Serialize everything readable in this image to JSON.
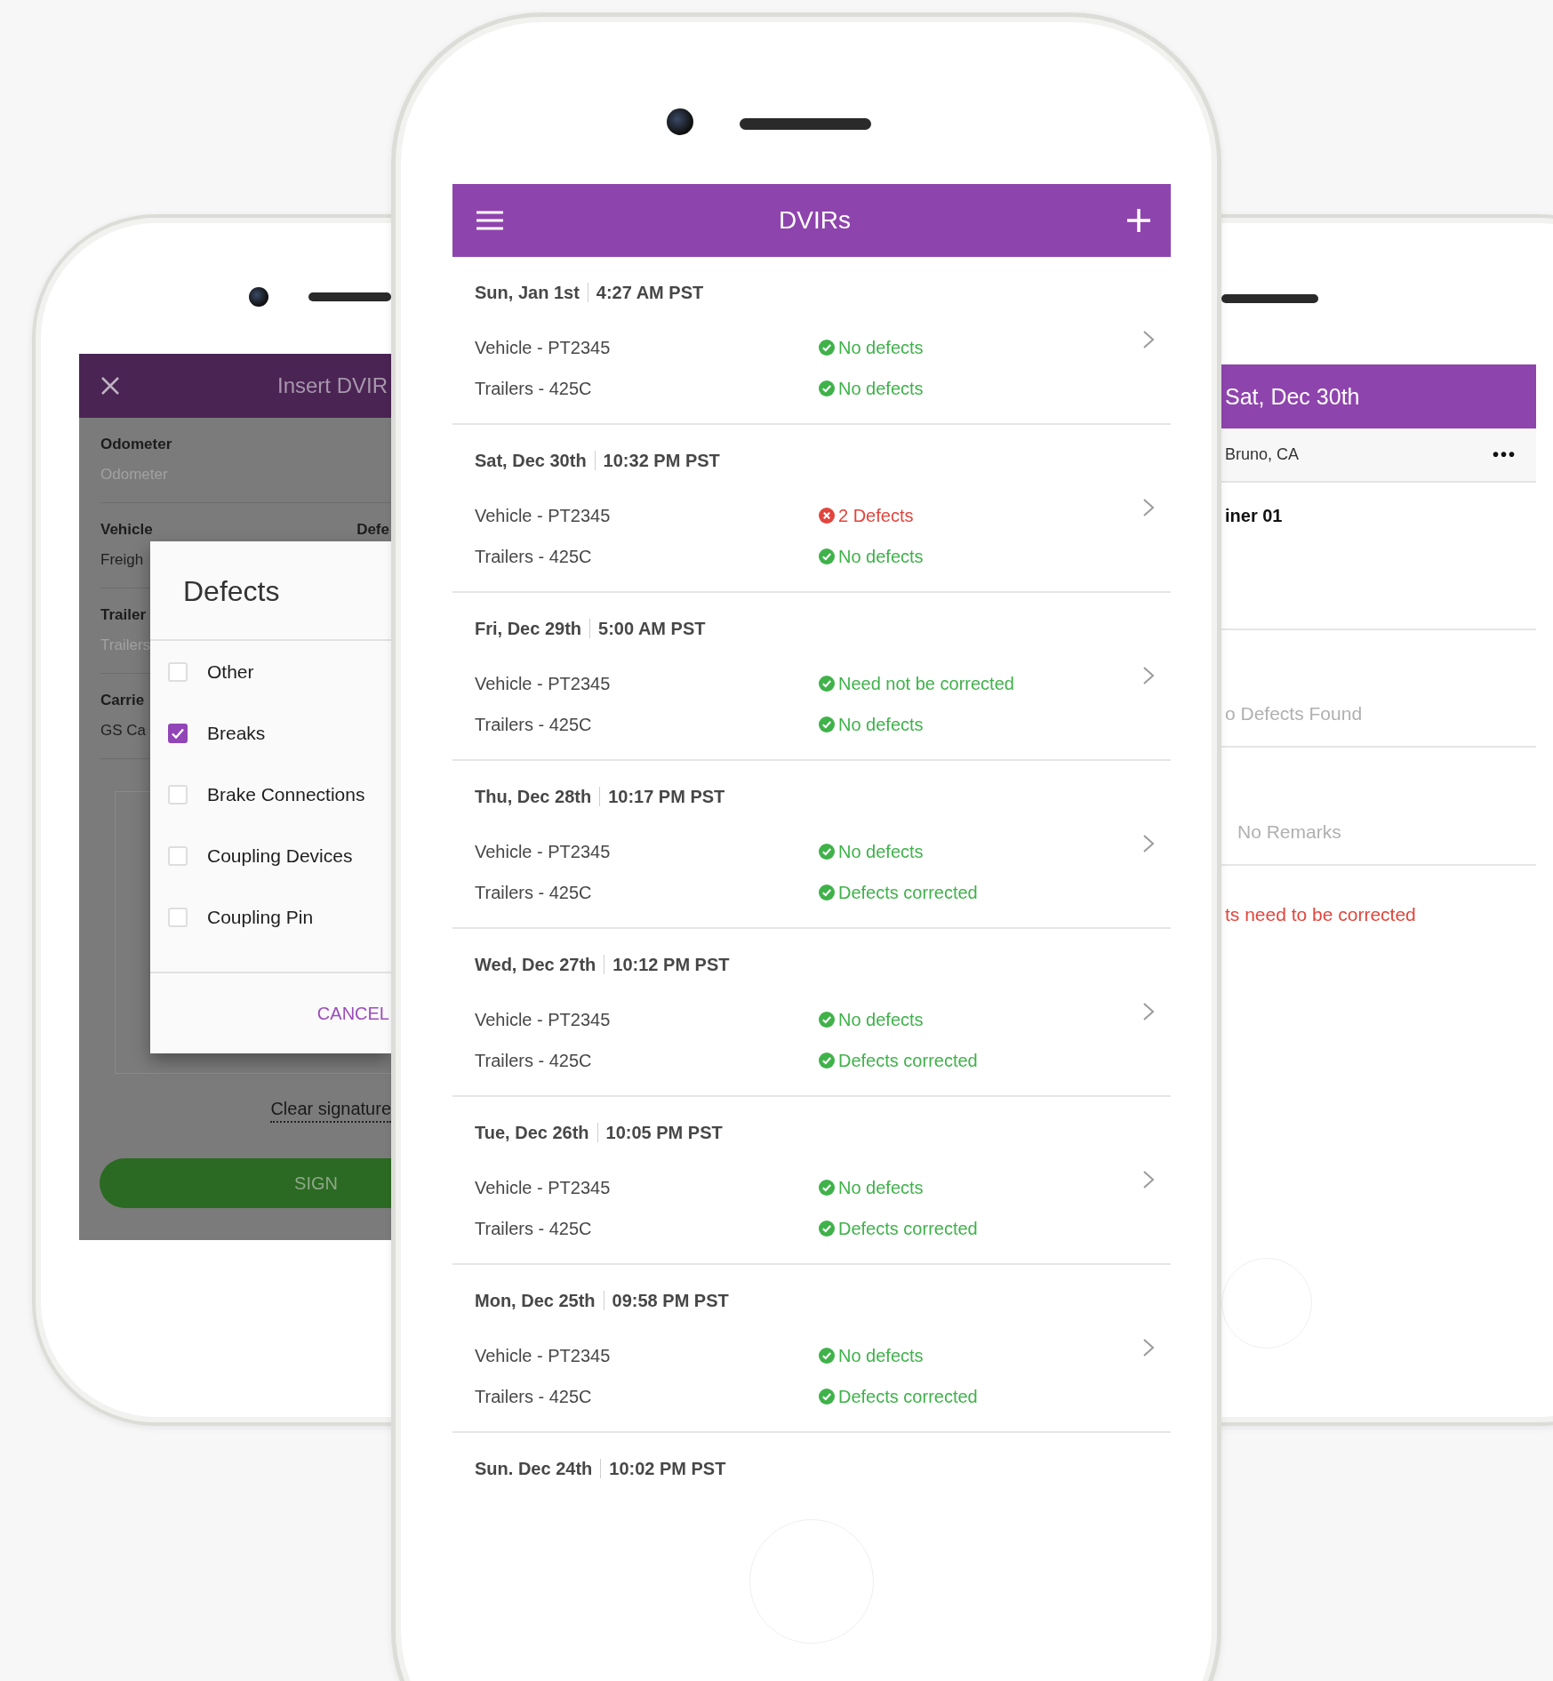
{
  "insert_dvir_phone": {
    "title": "Insert DVIR",
    "fields": [
      {
        "label": "Odometer",
        "placeholder": "Odometer"
      },
      {
        "label": "Vehicle",
        "value": "Freigh",
        "side_label": "Defe"
      },
      {
        "label": "Trailer",
        "placeholder": "Trailers"
      },
      {
        "label": "Carrie",
        "value": "GS Ca"
      }
    ],
    "defects_dialog": {
      "title": "Defects",
      "options": [
        {
          "label": "Other",
          "checked": false
        },
        {
          "label": "Breaks",
          "checked": true
        },
        {
          "label": "Brake Connections",
          "checked": false
        },
        {
          "label": "Coupling Devices",
          "checked": false
        },
        {
          "label": "Coupling Pin",
          "checked": false
        }
      ],
      "cancel": "CANCEL"
    },
    "clear_signature": "Clear signature",
    "sign": "SIGN"
  },
  "dvir_list_phone": {
    "title": "DVIRs",
    "entries": [
      {
        "date": "Sun, Jan 1st",
        "time": "4:27 AM PST",
        "items": [
          {
            "label": "Vehicle - PT2345",
            "status": "No defects",
            "kind": "ok"
          },
          {
            "label": "Trailers - 425C",
            "status": "No defects",
            "kind": "ok"
          }
        ]
      },
      {
        "date": "Sat, Dec 30th",
        "time": "10:32 PM PST",
        "items": [
          {
            "label": "Vehicle - PT2345",
            "status": "2 Defects",
            "kind": "defect"
          },
          {
            "label": "Trailers - 425C",
            "status": "No defects",
            "kind": "ok"
          }
        ]
      },
      {
        "date": "Fri, Dec 29th",
        "time": "5:00 AM PST",
        "items": [
          {
            "label": "Vehicle - PT2345",
            "status": "Need not be corrected",
            "kind": "ok"
          },
          {
            "label": "Trailers - 425C",
            "status": "No defects",
            "kind": "ok"
          }
        ]
      },
      {
        "date": "Thu, Dec 28th",
        "time": "10:17 PM PST",
        "items": [
          {
            "label": "Vehicle - PT2345",
            "status": "No defects",
            "kind": "ok"
          },
          {
            "label": "Trailers - 425C",
            "status": "Defects corrected",
            "kind": "ok"
          }
        ]
      },
      {
        "date": "Wed, Dec 27th",
        "time": "10:12 PM PST",
        "items": [
          {
            "label": "Vehicle - PT2345",
            "status": "No defects",
            "kind": "ok"
          },
          {
            "label": "Trailers - 425C",
            "status": "Defects corrected",
            "kind": "ok"
          }
        ]
      },
      {
        "date": "Tue, Dec 26th",
        "time": "10:05 PM PST",
        "items": [
          {
            "label": "Vehicle - PT2345",
            "status": "No defects",
            "kind": "ok"
          },
          {
            "label": "Trailers - 425C",
            "status": "Defects corrected",
            "kind": "ok"
          }
        ]
      },
      {
        "date": "Mon, Dec 25th",
        "time": "09:58 PM PST",
        "items": [
          {
            "label": "Vehicle - PT2345",
            "status": "No defects",
            "kind": "ok"
          },
          {
            "label": "Trailers - 425C",
            "status": "Defects corrected",
            "kind": "ok"
          }
        ]
      },
      {
        "date": "Sun. Dec 24th",
        "time": "10:02 PM PST"
      }
    ]
  },
  "detail_phone": {
    "title": "Sat, Dec 30th",
    "location": "Bruno, CA",
    "more": "•••",
    "trailer": "iner 01",
    "defects": "o Defects Found",
    "remarks": "No Remarks",
    "warning": "ts need to be corrected"
  }
}
